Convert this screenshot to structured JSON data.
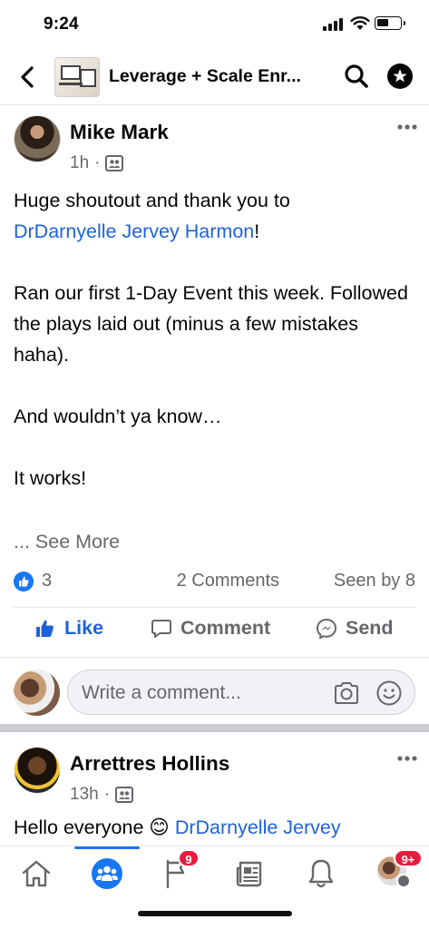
{
  "status_bar": {
    "time": "9:24"
  },
  "header": {
    "title": "Leverage + Scale Enr..."
  },
  "post": {
    "author": "Mike Mark",
    "time": "1h",
    "separator": "·",
    "line1": "Huge shoutout and thank you to",
    "mention": "DrDarnyelle Jervey Harmon",
    "mention_suffix": "!",
    "para2": "Ran our first 1-Day Event this week. Followed the plays laid out (minus a few mistakes haha).",
    "para3": "And wouldn’t ya know…",
    "para4": "It works!",
    "see_more": "... See More",
    "reaction_count": "3",
    "comments": "2 Comments",
    "seen_by": "Seen by 8"
  },
  "actions": {
    "like": "Like",
    "comment": "Comment",
    "send": "Send"
  },
  "comment_box": {
    "placeholder": "Write a comment..."
  },
  "post2": {
    "author": "Arrettres Hollins",
    "time": "13h",
    "separator": "·",
    "text_start": "Hello everyone",
    "emoji": "😊",
    "mention": "DrDarnyelle Jervey"
  },
  "bottom_nav": {
    "pages_badge": "9",
    "profile_badge": "9+"
  },
  "colors": {
    "accent": "#1877f2",
    "mention": "#1d63d8",
    "badge": "#e41e3f"
  },
  "icons": [
    "back-icon",
    "search-icon",
    "admin-badge-icon",
    "more-icon",
    "audience-icon",
    "like-icon",
    "comment-icon",
    "messenger-icon",
    "camera-icon",
    "emoji-icon",
    "home-icon",
    "groups-icon",
    "pages-flag-icon",
    "news-icon",
    "bell-icon"
  ]
}
